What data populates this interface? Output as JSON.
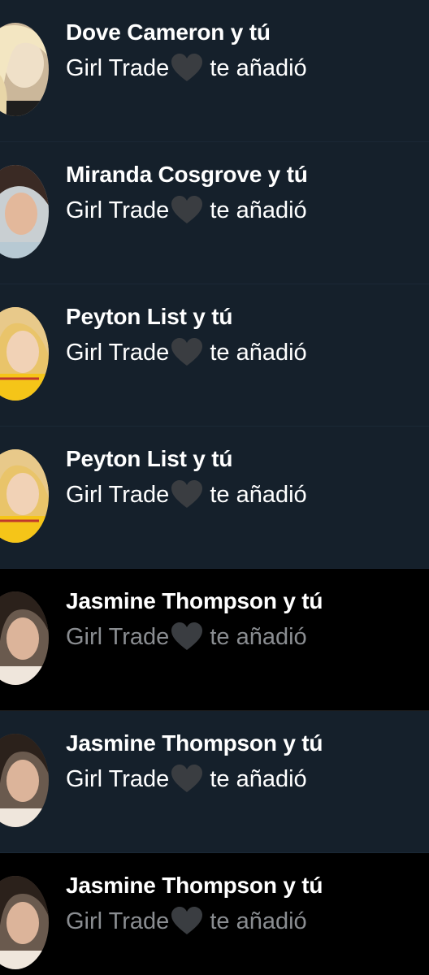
{
  "theme": {
    "row_dark": "#15202b",
    "row_black": "#000000",
    "text_primary": "#ffffff",
    "text_muted": "#8a8d91",
    "heart_color": "#3a3d41"
  },
  "notifications": [
    {
      "title": "Dove Cameron y tú",
      "group_name": "Girl Trade",
      "heart_icon": "black-heart-emoji",
      "action": "te añadió",
      "avatar": "dove-cameron-avatar",
      "background": "dark"
    },
    {
      "title": "Miranda Cosgrove y tú",
      "group_name": "Girl Trade",
      "heart_icon": "black-heart-emoji",
      "action": "te añadió",
      "avatar": "miranda-cosgrove-avatar",
      "background": "dark"
    },
    {
      "title": "Peyton List y tú",
      "group_name": "Girl Trade",
      "heart_icon": "black-heart-emoji",
      "action": "te añadió",
      "avatar": "peyton-list-avatar",
      "background": "dark"
    },
    {
      "title": "Peyton List y tú",
      "group_name": "Girl Trade",
      "heart_icon": "black-heart-emoji",
      "action": "te añadió",
      "avatar": "peyton-list-avatar",
      "background": "dark"
    },
    {
      "title": "Jasmine Thompson y tú",
      "group_name": "Girl Trade",
      "heart_icon": "black-heart-emoji",
      "action": "te añadió",
      "avatar": "jasmine-thompson-avatar",
      "background": "black"
    },
    {
      "title": "Jasmine Thompson y tú",
      "group_name": "Girl Trade",
      "heart_icon": "black-heart-emoji",
      "action": "te añadió",
      "avatar": "jasmine-thompson-avatar",
      "background": "dark"
    },
    {
      "title": "Jasmine Thompson y tú",
      "group_name": "Girl Trade",
      "heart_icon": "black-heart-emoji",
      "action": "te añadió",
      "avatar": "jasmine-thompson-avatar",
      "background": "black"
    }
  ]
}
